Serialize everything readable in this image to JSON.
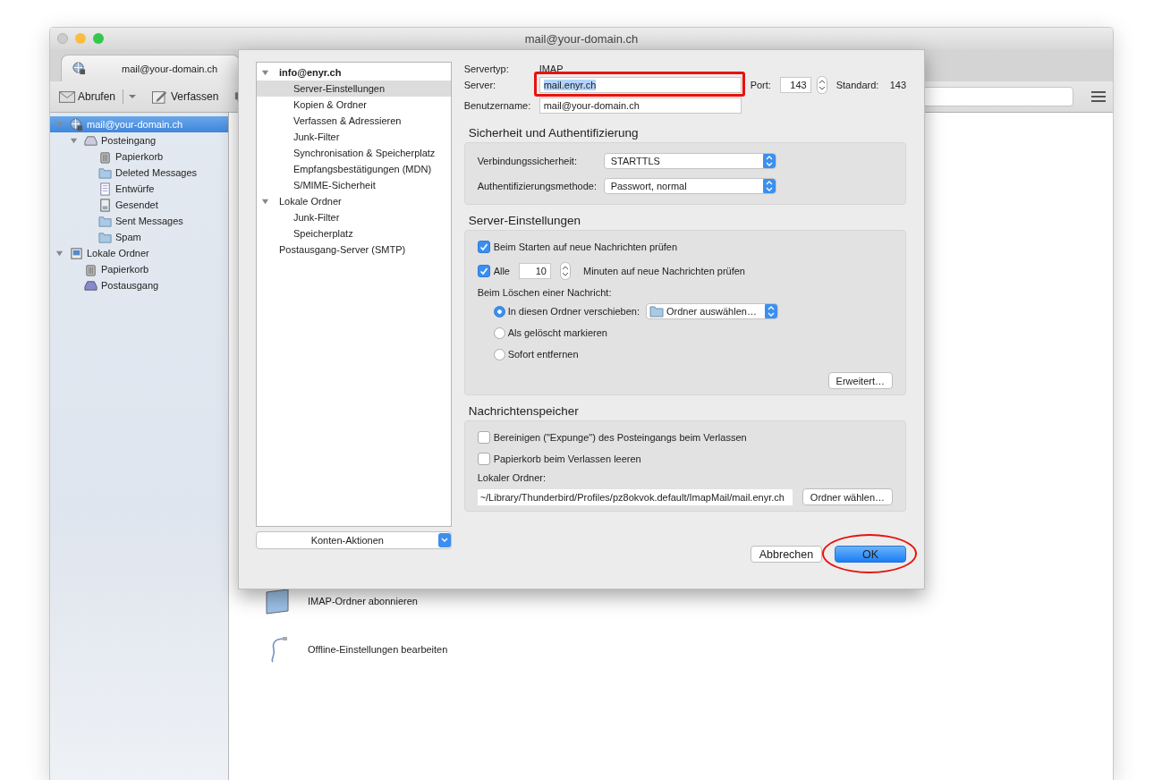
{
  "window": {
    "title": "mail@your-domain.ch"
  },
  "tab": {
    "label": "mail@your-domain.ch"
  },
  "toolbar": [
    {
      "label": "Abrufen",
      "kind": "get",
      "menu": true
    },
    {
      "label": "Verfassen",
      "kind": "compose",
      "menu": false
    }
  ],
  "folders": [
    {
      "label": "mail@your-domain.ch",
      "kind": "account",
      "selected": true,
      "expanded": true,
      "children": [
        {
          "label": "Posteingang",
          "kind": "inbox",
          "selected": false,
          "expanded": true,
          "children": [
            {
              "label": "Papierkorb",
              "kind": "trash",
              "selected": false
            },
            {
              "label": "Deleted Messages",
              "kind": "folder",
              "selected": false
            },
            {
              "label": "Entwürfe",
              "kind": "drafts",
              "selected": false
            },
            {
              "label": "Gesendet",
              "kind": "sent",
              "selected": false
            },
            {
              "label": "Sent Messages",
              "kind": "folder",
              "selected": false
            },
            {
              "label": "Spam",
              "kind": "folder",
              "selected": false
            }
          ]
        }
      ]
    },
    {
      "label": "Lokale Ordner",
      "kind": "local",
      "selected": false,
      "expanded": true,
      "children": [
        {
          "label": "Papierkorb",
          "kind": "trash",
          "selected": false
        },
        {
          "label": "Postausgang",
          "kind": "outbox",
          "selected": false
        }
      ]
    }
  ],
  "actions": [
    {
      "label": "IMAP-Ordner abonnieren",
      "kind": "folder"
    },
    {
      "label": "Offline-Einstellungen bearbeiten",
      "kind": "cable"
    }
  ],
  "dialog": {
    "tree": [
      {
        "label": "info@enyr.ch",
        "current": true,
        "selected": false,
        "expanded": true,
        "children": [
          {
            "label": "Server-Einstellungen",
            "selected": true
          },
          {
            "label": "Kopien & Ordner",
            "selected": false
          },
          {
            "label": "Verfassen & Adressieren",
            "selected": false
          },
          {
            "label": "Junk-Filter",
            "selected": false
          },
          {
            "label": "Synchronisation & Speicherplatz",
            "selected": false
          },
          {
            "label": "Empfangsbestätigungen (MDN)",
            "selected": false
          },
          {
            "label": "S/MIME-Sicherheit",
            "selected": false
          }
        ]
      },
      {
        "label": "Lokale Ordner",
        "current": false,
        "selected": false,
        "expanded": true,
        "children": [
          {
            "label": "Junk-Filter",
            "selected": false
          },
          {
            "label": "Speicherplatz",
            "selected": false
          }
        ]
      },
      {
        "label": "Postausgang-Server (SMTP)",
        "current": false,
        "selected": false
      }
    ],
    "account_actions": "Konten-Aktionen",
    "server_type_label": "Servertyp:",
    "server_type": "IMAP",
    "server_label": "Server:",
    "server": "mail.enyr.ch",
    "server_text_selected": true,
    "server_highlighted": true,
    "port_label": "Port:",
    "port": "143",
    "default_label": "Standard:",
    "default_port": "143",
    "username_label": "Benutzername:",
    "username": "mail@your-domain.ch",
    "security": {
      "heading": "Sicherheit und Authentifizierung",
      "rows": [
        {
          "label": "Verbindungssicherheit:",
          "value": "STARTTLS"
        },
        {
          "label": "Authentifizierungsmethode:",
          "value": "Passwort, normal"
        }
      ]
    },
    "server_settings": {
      "heading": "Server-Einstellungen",
      "items": [
        {
          "kind": "checkbox",
          "label": "Beim Starten auf neue Nachrichten prüfen",
          "checked": true
        },
        {
          "kind": "interval",
          "label": "Alle",
          "checked": true,
          "value": "10",
          "suffix": "Minuten auf neue Nachrichten prüfen"
        },
        {
          "kind": "label",
          "label": "Beim Löschen einer Nachricht:"
        },
        {
          "kind": "radio",
          "label": "In diesen Ordner verschieben:",
          "selected": true,
          "select": "Ordner auswählen…"
        },
        {
          "kind": "radio",
          "label": "Als gelöscht markieren",
          "selected": false
        },
        {
          "kind": "radio",
          "label": "Sofort entfernen",
          "selected": false
        },
        {
          "kind": "button",
          "label": "Erweitert…"
        }
      ]
    },
    "storage": {
      "heading": "Nachrichtenspeicher",
      "items": [
        {
          "kind": "checkbox",
          "label": "Bereinigen (\"Expunge\") des Posteingangs beim Verlassen",
          "checked": false
        },
        {
          "kind": "checkbox",
          "label": "Papierkorb beim Verlassen leeren",
          "checked": false
        },
        {
          "kind": "label",
          "label": "Lokaler Ordner:"
        },
        {
          "kind": "path",
          "value": "~/Library/Thunderbird/Profiles/pz8okvok.default/ImapMail/mail.enyr.ch",
          "button": "Ordner wählen…"
        }
      ]
    },
    "buttons": [
      {
        "label": "Abbrechen",
        "default": false,
        "highlighted": false
      },
      {
        "label": "OK",
        "default": true,
        "highlighted": true
      }
    ]
  }
}
